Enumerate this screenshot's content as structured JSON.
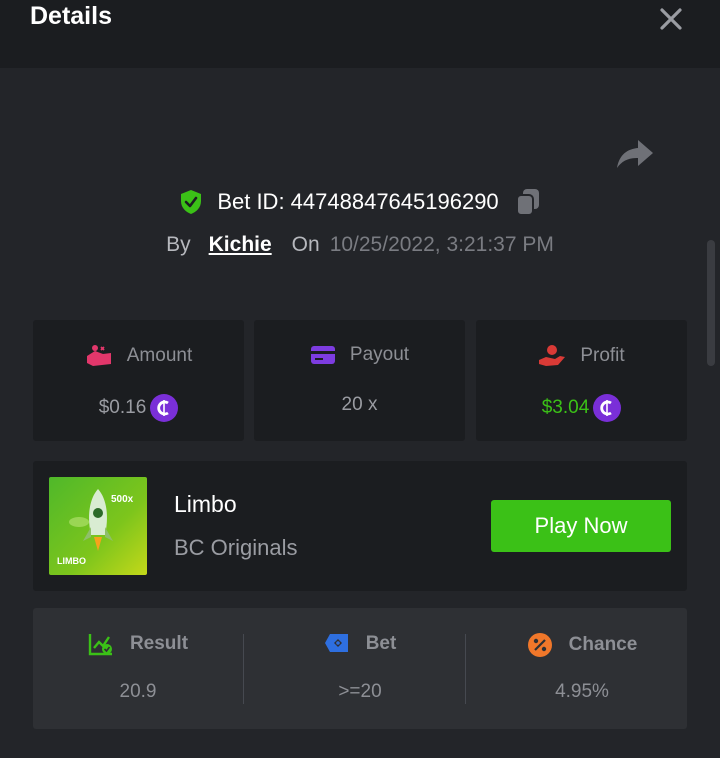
{
  "header": {
    "title": "Details"
  },
  "bet": {
    "id_text": "Bet ID: 447488476451962​90",
    "by_label": "By",
    "username": "Kichie",
    "on_label": "On",
    "datetime": "10/25/2022, 3:21:37 PM"
  },
  "stats": {
    "amount": {
      "label": "Amount",
      "value": "$0.16",
      "icon": "wallet-icon"
    },
    "payout": {
      "label": "Payout",
      "value": "20 x",
      "icon": "card-icon"
    },
    "profit": {
      "label": "Profit",
      "value": "$3.04",
      "icon": "hand-coin-icon"
    }
  },
  "game": {
    "thumb_badge": "500x",
    "thumb_name": "LIMBO",
    "title": "Limbo",
    "provider": "BC Originals",
    "play_label": "Play Now"
  },
  "result": {
    "result_label": "Result",
    "result_value": "20.9",
    "bet_label": "Bet",
    "bet_value": ">=20",
    "chance_label": "Chance",
    "chance_value": "4.95%"
  },
  "colors": {
    "accent_green": "#3bc117",
    "coin_purple": "#7a2fd8",
    "amount_pink": "#e2376b",
    "payout_purple": "#7d3ce0",
    "profit_red": "#d93a36",
    "chance_orange": "#f0772a",
    "bet_blue": "#2e6fe0"
  }
}
